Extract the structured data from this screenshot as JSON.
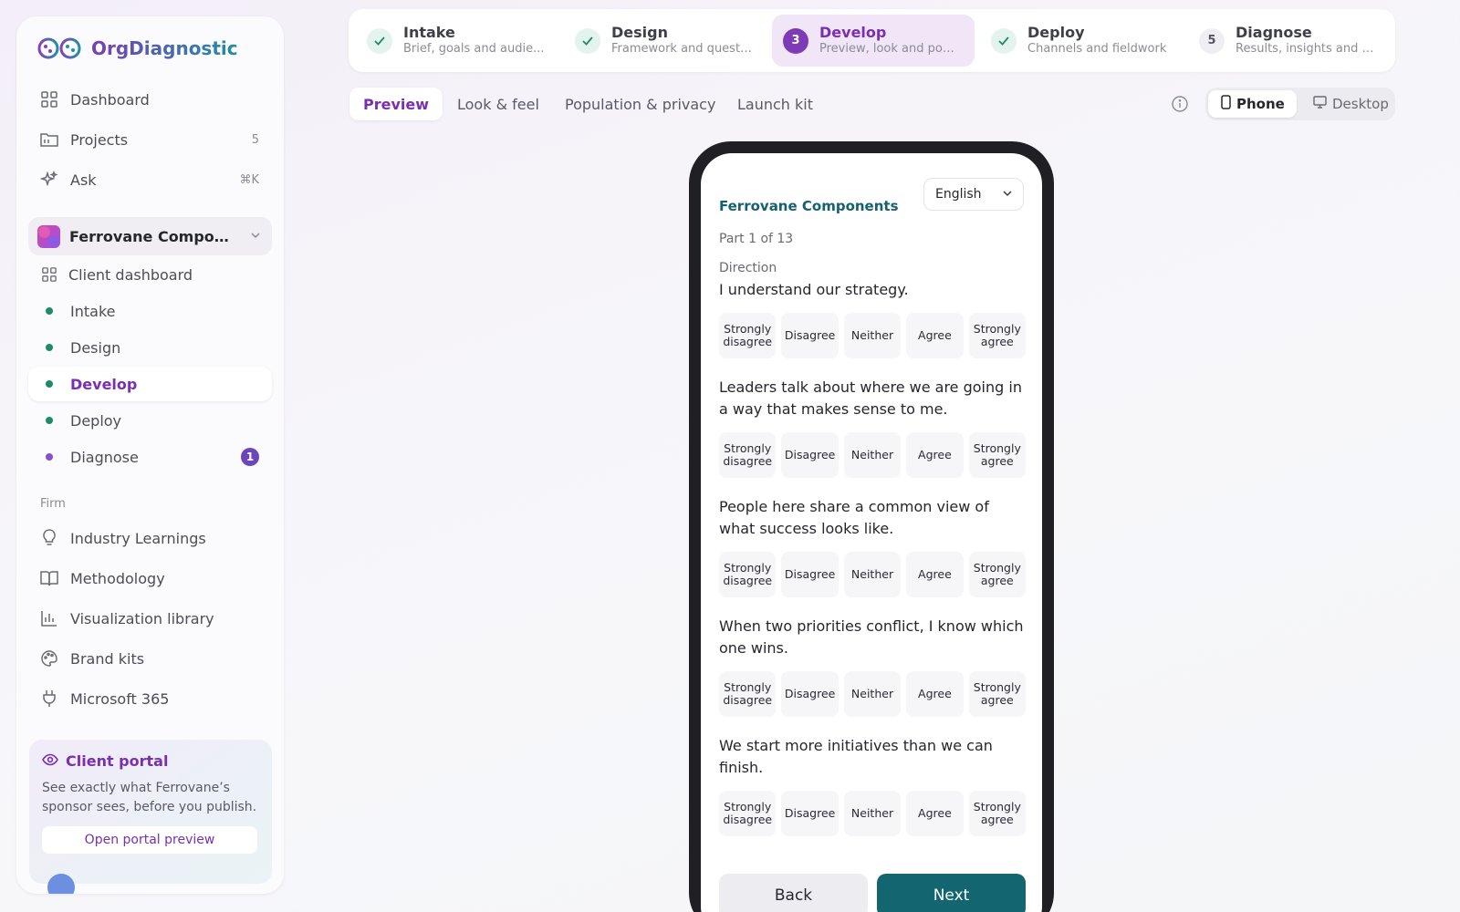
{
  "app": {
    "name": "OrgDiagnostic"
  },
  "sidebar": {
    "main_items": [
      {
        "label": "Dashboard",
        "icon": "grid-icon",
        "meta": ""
      },
      {
        "label": "Projects",
        "icon": "folder-icon",
        "meta": "5"
      },
      {
        "label": "Ask",
        "icon": "sparkle-icon",
        "meta": "⌘K"
      }
    ],
    "client": {
      "name": "Ferrovane Compone...",
      "dashboard_label": "Client dashboard",
      "stages": [
        {
          "label": "Intake",
          "status": "done",
          "dot_color": "#1f8a6a"
        },
        {
          "label": "Design",
          "status": "done",
          "dot_color": "#1f8a6a"
        },
        {
          "label": "Develop",
          "status": "active",
          "dot_color": "#1f8a6a"
        },
        {
          "label": "Deploy",
          "status": "done",
          "dot_color": "#1f8a6a"
        },
        {
          "label": "Diagnose",
          "status": "pending",
          "dot_color": "#8a4fc6",
          "badge": "1"
        }
      ]
    },
    "firm_label": "Firm",
    "firm_items": [
      {
        "label": "Industry Learnings",
        "icon": "lightbulb-icon"
      },
      {
        "label": "Methodology",
        "icon": "book-icon"
      },
      {
        "label": "Visualization library",
        "icon": "bar-chart-icon"
      },
      {
        "label": "Brand kits",
        "icon": "palette-icon"
      },
      {
        "label": "Microsoft 365",
        "icon": "plug-icon"
      }
    ],
    "portal": {
      "title": "Client portal",
      "text": "See exactly what Ferrovane’s sponsor sees, before you publish.",
      "button": "Open portal preview"
    }
  },
  "stepper": [
    {
      "title": "Intake",
      "subtitle": "Brief, goals and audie...",
      "state": "done",
      "marker": ""
    },
    {
      "title": "Design",
      "subtitle": "Framework and questi...",
      "state": "done",
      "marker": ""
    },
    {
      "title": "Develop",
      "subtitle": "Preview, look and pop...",
      "state": "current",
      "marker": "3"
    },
    {
      "title": "Deploy",
      "subtitle": "Channels and fieldwork",
      "state": "done",
      "marker": ""
    },
    {
      "title": "Diagnose",
      "subtitle": "Results, insights and r...",
      "state": "todo",
      "marker": "5"
    }
  ],
  "tabs": [
    {
      "label": "Preview",
      "active": true
    },
    {
      "label": "Look & feel",
      "active": false
    },
    {
      "label": "Population & privacy",
      "active": false
    },
    {
      "label": "Launch kit",
      "active": false
    }
  ],
  "device_toggle": {
    "phone": "Phone",
    "desktop": "Desktop",
    "selected": "Phone"
  },
  "survey": {
    "brand": "Ferrovane Components",
    "language": "English",
    "part": "Part 1 of 13",
    "section": "Direction",
    "scale": [
      "Strongly disagree",
      "Disagree",
      "Neither",
      "Agree",
      "Strongly agree"
    ],
    "questions": [
      "I understand our strategy.",
      "Leaders talk about where we are going in a way that makes sense to me.",
      "People here share a common view of what success looks like.",
      "When two priorities conflict, I know which one wins.",
      "We start more initiatives than we can finish."
    ],
    "back": "Back",
    "next": "Next"
  },
  "colors": {
    "accent": "#7a2fb0",
    "teal": "#136570",
    "done_green": "#1f8a6a"
  }
}
